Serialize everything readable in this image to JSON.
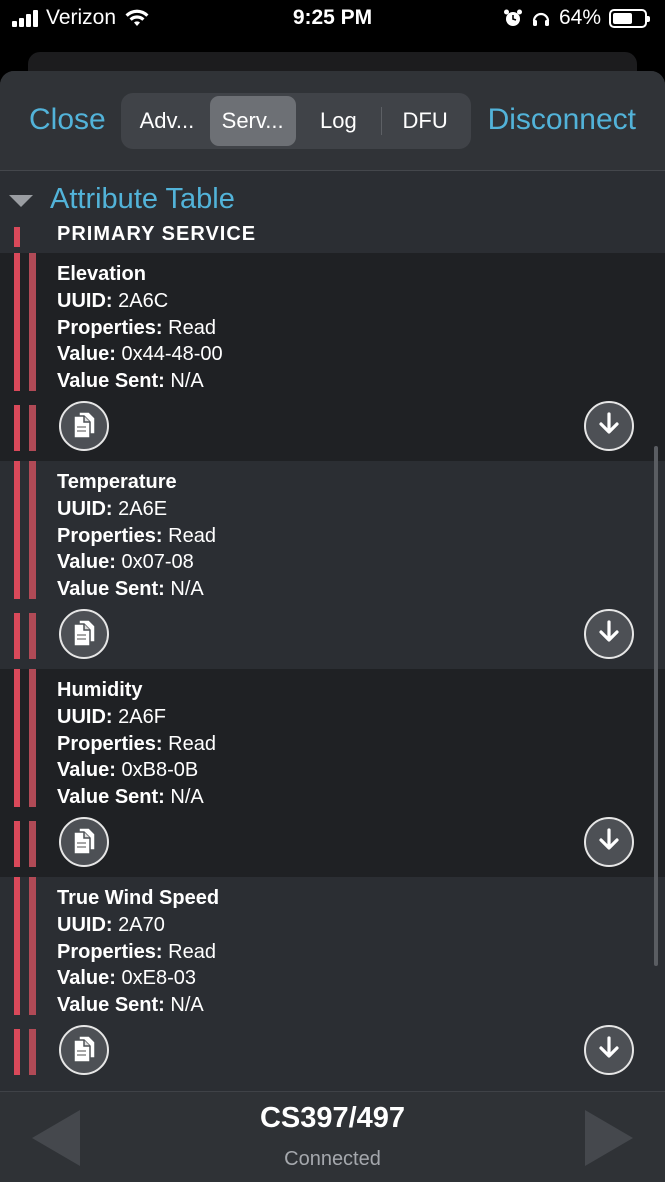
{
  "status_bar": {
    "carrier": "Verizon",
    "time": "9:25 PM",
    "battery": "64%",
    "battery_level": 0.64,
    "icons": [
      "signal-icon",
      "wifi-icon",
      "alarm-icon",
      "headphones-icon",
      "battery-icon"
    ]
  },
  "toolbar": {
    "close_label": "Close",
    "disconnect_label": "Disconnect",
    "tabs": [
      {
        "label": "Adv...",
        "selected": false
      },
      {
        "label": "Serv...",
        "selected": true
      },
      {
        "label": "Log",
        "selected": false
      },
      {
        "label": "DFU",
        "selected": false
      }
    ]
  },
  "section": {
    "title": "Attribute Table",
    "service_type": "PRIMARY SERVICE"
  },
  "field_labels": {
    "uuid": "UUID:",
    "properties": "Properties:",
    "value": "Value:",
    "value_sent": "Value Sent:"
  },
  "characteristics": [
    {
      "name": "Elevation",
      "uuid": "2A6C",
      "properties": "Read",
      "value": "0x44-48-00",
      "value_sent": "N/A"
    },
    {
      "name": "Temperature",
      "uuid": "2A6E",
      "properties": "Read",
      "value": "0x07-08",
      "value_sent": "N/A"
    },
    {
      "name": "Humidity",
      "uuid": "2A6F",
      "properties": "Read",
      "value": "0xB8-0B",
      "value_sent": "N/A"
    },
    {
      "name": "True Wind Speed",
      "uuid": "2A70",
      "properties": "Read",
      "value": "0xE8-03",
      "value_sent": "N/A"
    }
  ],
  "footer": {
    "device_name": "CS397/497",
    "connection_status": "Connected"
  },
  "colors": {
    "accent": "#52b3d9",
    "indicator_red": "#d9495a",
    "background": "#2b2e33"
  }
}
